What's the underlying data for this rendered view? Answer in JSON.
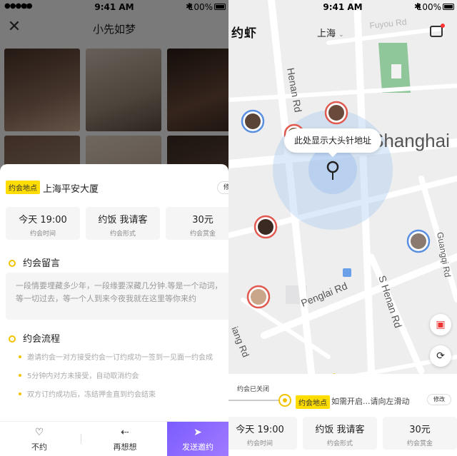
{
  "status": {
    "time": "9:41 AM",
    "battery": "100%"
  },
  "left": {
    "title": "小先如梦",
    "address_tag": "约会地点",
    "address": "上海平安大厦",
    "modify": "修改",
    "cards": [
      {
        "value": "今天 19:00",
        "label": "约会时间"
      },
      {
        "value": "约饭 我请客",
        "label": "约会形式"
      },
      {
        "value": "30元",
        "label": "约会赏金"
      }
    ],
    "message_title": "约会留言",
    "message": "一段情要埋藏多少年，一段缘要深藏几分钟.等是一个动词，等一切过去，等一个人到来今夜我就在这里等你来约",
    "flow_title": "约会流程",
    "flow": [
      "邀请约会一对方接受约会一订约成功一签到一见面一约会成",
      "5分钟内对方未接受，自动取消约会",
      "双方订约成功后，冻结押金直到约会结束"
    ],
    "bottom": {
      "dislike": "不约",
      "rethink": "再想想",
      "send": "发送邀约"
    },
    "photo_colors": [
      "#6a4e3e",
      "#b9a696",
      "#3e2a22",
      "#8a6a58",
      "#d9c8b8",
      "#5a3c2c"
    ]
  },
  "right": {
    "logo": "约虾",
    "city": "上海",
    "callout": "此处显示大头针地址",
    "map_labels": {
      "fuyou": "Fuyou Rd",
      "henan": "Henan Rd",
      "shanghai": "Shanghai",
      "guangqi": "Guangqi Rd",
      "penglai": "Penglai Rd",
      "s_henan": "S Henan Rd",
      "jiang": "iang Rd"
    },
    "panel": {
      "closed": "约会已关闭",
      "tag": "约会地点",
      "hint": "如需开启...请向左滑动",
      "modify": "修改",
      "cards": [
        {
          "value": "今天 19:00",
          "label": "约会时间"
        },
        {
          "value": "约饭 我请客",
          "label": "约会形式"
        },
        {
          "value": "30元",
          "label": "约会赏金"
        }
      ]
    }
  }
}
